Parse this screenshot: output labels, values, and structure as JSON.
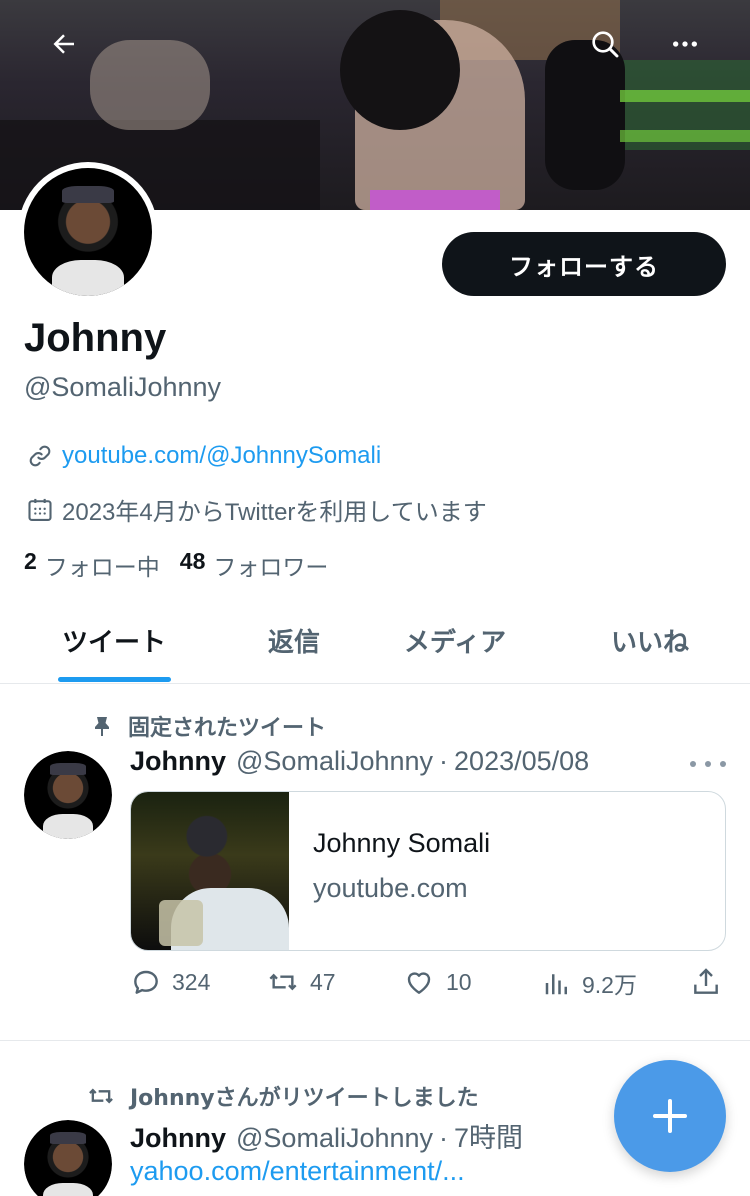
{
  "header": {
    "back_icon": "arrow-left-icon",
    "search_icon": "search-icon",
    "more_icon": "more-horizontal-icon"
  },
  "profile": {
    "display_name": "Johnny",
    "handle": "@SomaliJohnny",
    "follow_button_label": "フォローする",
    "website": "youtube.com/@JohnnySomali",
    "joined": "2023年4月からTwitterを利用しています",
    "following_count": "2",
    "following_label": "フォロー中",
    "followers_count": "48",
    "followers_label": "フォロワー"
  },
  "tabs": [
    {
      "label": "ツイート",
      "active": true
    },
    {
      "label": "返信",
      "active": false
    },
    {
      "label": "メディア",
      "active": false
    },
    {
      "label": "いいね",
      "active": false
    }
  ],
  "tweets": [
    {
      "context": "固定されたツイート",
      "context_icon": "pin-icon",
      "name": "Johnny",
      "handle": "@SomaliJohnny",
      "separator": "·",
      "time": "2023/05/08",
      "card": {
        "title": "Johnny Somali",
        "domain": "youtube.com"
      },
      "replies": "324",
      "retweets": "47",
      "likes": "10",
      "views": "9.2万"
    },
    {
      "context": "Johnnyさんがリツイートしました",
      "context_icon": "retweet-icon",
      "name": "Johnny",
      "handle": "@SomaliJohnny",
      "separator": "·",
      "time": "7時間",
      "link_text": "yahoo.com/entertainment/..."
    }
  ],
  "fab_icon": "plus-icon",
  "colors": {
    "accent": "#1d9bf0",
    "fab": "#4b9ae8",
    "text": "#0f1419",
    "secondary": "#536471"
  }
}
